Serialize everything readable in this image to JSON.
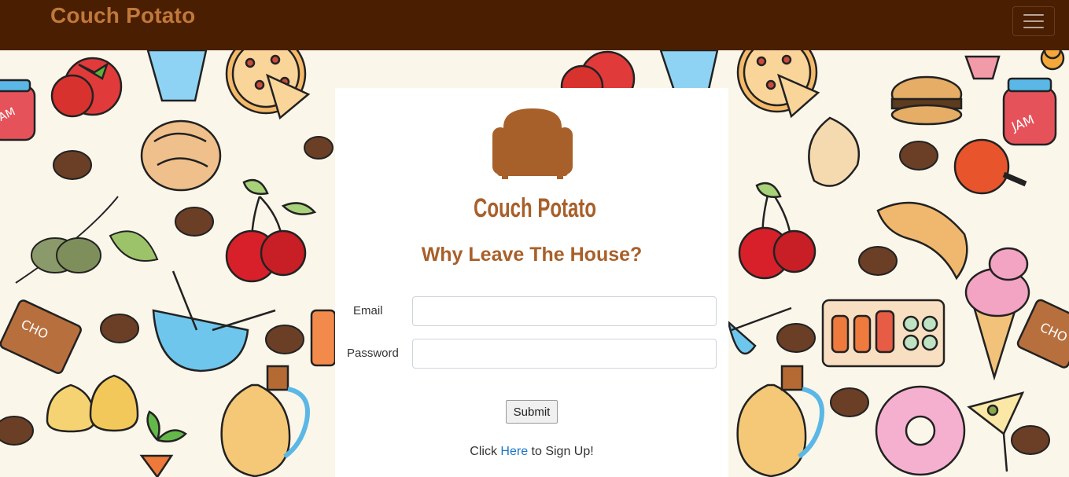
{
  "navbar": {
    "brand": "Couch Potato",
    "toggle_icon": "hamburger-menu-icon"
  },
  "background": {
    "pattern": "food-doodle-pattern",
    "items": [
      "tomato",
      "jam-jar",
      "pizza",
      "cherry",
      "coffee-bean",
      "bread",
      "olive-branch",
      "bowl",
      "chocolate",
      "pear",
      "carrot",
      "oil-bottle",
      "burger",
      "chicken-leg",
      "croissant",
      "sushi",
      "ice-cream",
      "donut",
      "cocktail"
    ],
    "jam_label": "JAM",
    "choco_label": "CHO"
  },
  "card": {
    "logo_text": "Couch Potato",
    "logo_icon": "armchair-icon",
    "heading": "Why Leave The House?",
    "email_label": "Email",
    "email_value": "",
    "password_label": "Password",
    "password_value": "",
    "submit_label": "Submit",
    "signup_prefix": "Click ",
    "signup_link": "Here",
    "signup_suffix": " to Sign Up!"
  },
  "colors": {
    "navbar_bg": "#4a1e00",
    "brand": "#c0783b",
    "heading": "#a8602a",
    "logo": "#a8602a",
    "link": "#1a73c8",
    "background": "#fbf6ea"
  }
}
